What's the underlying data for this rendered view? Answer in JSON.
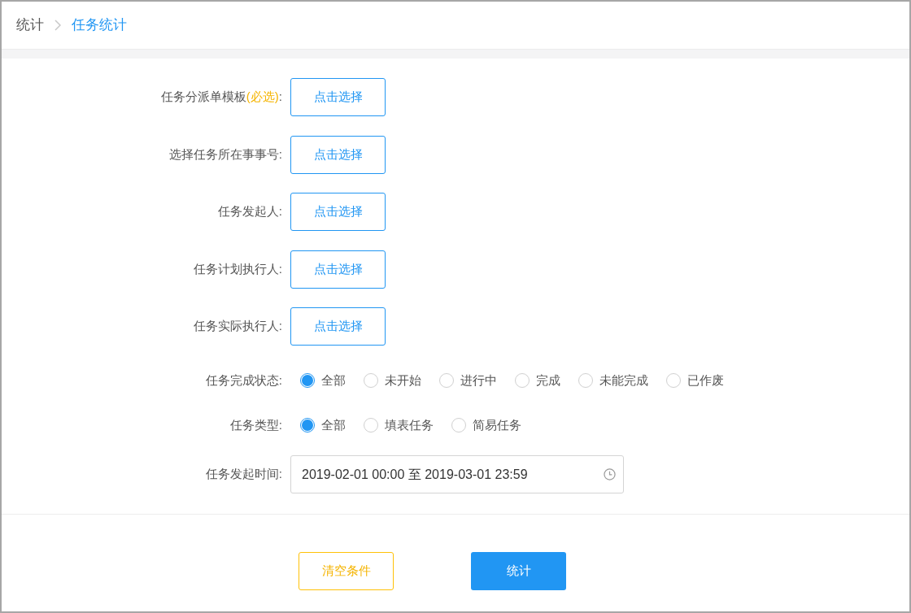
{
  "breadcrumb": [
    {
      "label": "统计",
      "current": false
    },
    {
      "label": "任务统计",
      "current": true
    }
  ],
  "pickers": [
    {
      "label": "任务分派单模板",
      "note": "(必选)",
      "tail": ":",
      "button": "点击选择"
    },
    {
      "label": "选择任务所在事事号:",
      "button": "点击选择"
    },
    {
      "label": "任务发起人:",
      "button": "点击选择"
    },
    {
      "label": "任务计划执行人:",
      "button": "点击选择"
    },
    {
      "label": "任务实际执行人:",
      "button": "点击选择"
    }
  ],
  "radio_groups": [
    {
      "label": "任务完成状态:",
      "options": [
        {
          "label": "全部",
          "selected": true
        },
        {
          "label": "未开始",
          "selected": false
        },
        {
          "label": "进行中",
          "selected": false
        },
        {
          "label": "完成",
          "selected": false
        },
        {
          "label": "未能完成",
          "selected": false
        },
        {
          "label": "已作废",
          "selected": false
        }
      ]
    },
    {
      "label": "任务类型:",
      "options": [
        {
          "label": "全部",
          "selected": true
        },
        {
          "label": "填表任务",
          "selected": false
        },
        {
          "label": "简易任务",
          "selected": false
        }
      ]
    }
  ],
  "date_range": {
    "label": "任务发起时间:",
    "value": "2019-02-01 00:00 至 2019-03-01 23:59"
  },
  "actions": [
    {
      "kind": "outline",
      "label": "清空条件"
    },
    {
      "kind": "primary",
      "label": "统计"
    }
  ]
}
